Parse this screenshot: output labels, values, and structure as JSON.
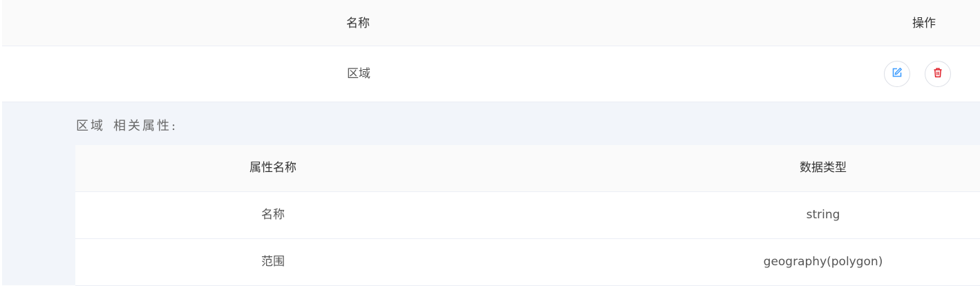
{
  "main_table": {
    "headers": {
      "name": "名称",
      "actions": "操作"
    },
    "rows": [
      {
        "name": "区域"
      }
    ]
  },
  "expanded": {
    "title_name": "区域",
    "title_suffix": "相关属性:",
    "attr_table": {
      "headers": {
        "attr_name": "属性名称",
        "data_type": "数据类型"
      },
      "rows": [
        {
          "attr_name": "名称",
          "data_type": "string"
        },
        {
          "attr_name": "范围",
          "data_type": "geography(polygon)"
        }
      ]
    }
  },
  "icons": {
    "edit": "edit-icon",
    "delete": "trash-icon"
  },
  "colors": {
    "edit": "#409eff",
    "delete": "#e0202a",
    "expand_bg": "#f2f5fa",
    "header_bg": "#fafafa"
  }
}
